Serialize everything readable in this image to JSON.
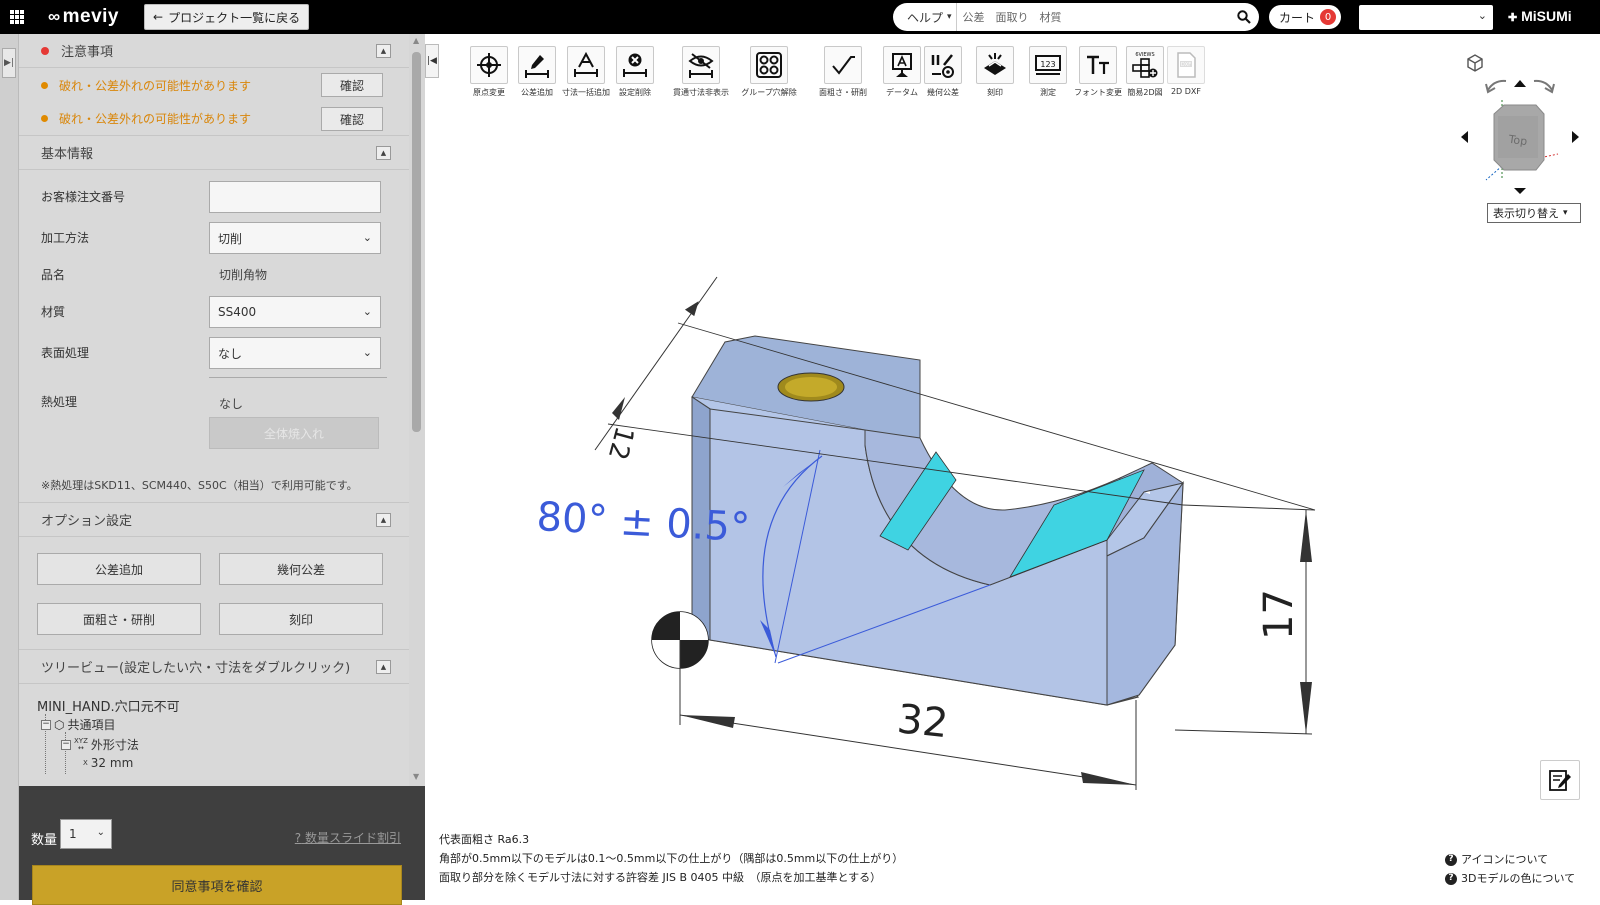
{
  "header": {
    "logo": "meviy",
    "back_button": "プロジェクト一覧に戻る",
    "help_select": "ヘルプ",
    "search_placeholder": "公差　面取り　材質",
    "cart_label": "カート",
    "cart_count": "0",
    "account_select": "",
    "brand": "MiSUMi"
  },
  "notice": {
    "title": "注意事項",
    "items": [
      {
        "text": "破れ・公差外れの可能性があります",
        "button": "確認"
      },
      {
        "text": "破れ・公差外れの可能性があります",
        "button": "確認"
      }
    ]
  },
  "basic_info": {
    "title": "基本情報",
    "order_no_label": "お客様注文番号",
    "order_no_value": "",
    "process_label": "加工方法",
    "process_value": "切削",
    "product_label": "品名",
    "product_value": "切削角物",
    "material_label": "材質",
    "material_value": "SS400",
    "surface_label": "表面処理",
    "surface_value": "なし",
    "heat_label": "熱処理",
    "heat_value": "なし",
    "apply_all_button": "全体焼入れ",
    "heat_note": "※熱処理はSKD11、SCM440、S50C（相当）で利用可能です。"
  },
  "options": {
    "title": "オプション設定",
    "buttons": [
      "公差追加",
      "幾何公差",
      "面粗さ・研削",
      "刻印"
    ]
  },
  "tree": {
    "title": "ツリービュー(設定したい穴・寸法をダブルクリック)",
    "root": "MINI_HAND.穴口元不可",
    "common": "共通項目",
    "outer": "外形寸法",
    "outer_icon_text": "XYZ",
    "x_dim_axis": "X",
    "x_dim": "32 mm"
  },
  "bottom": {
    "qty_label": "数量",
    "qty_value": "1",
    "qty_link": "数量スライド割引",
    "agree_button": "同意事項を確認"
  },
  "toolbar": [
    {
      "icon": "origin-icon",
      "label": "原点変更"
    },
    {
      "icon": "tolerance-add-icon",
      "label": "公差追加"
    },
    {
      "icon": "bulk-dimension-icon",
      "label": "寸法一括追加"
    },
    {
      "icon": "delete-setting-icon",
      "label": "設定削除"
    },
    {
      "icon": "hide-dimension-icon",
      "label": "貫通寸法非表示"
    },
    {
      "icon": "group-hole-icon",
      "label": "グループ穴解除"
    },
    {
      "icon": "roughness-icon",
      "label": "面粗さ・研削"
    },
    {
      "icon": "datum-icon",
      "label": "データム"
    },
    {
      "icon": "geometric-tolerance-icon",
      "label": "幾何公差"
    },
    {
      "icon": "engrave-icon",
      "label": "刻印"
    },
    {
      "icon": "measure-icon",
      "label": "測定"
    },
    {
      "icon": "font-change-icon",
      "label": "フォント変更"
    },
    {
      "icon": "simple-2d-icon",
      "label": "簡易2D図",
      "badge": "6VIEWS"
    },
    {
      "icon": "dxf-icon",
      "label": "2D DXF",
      "badge": "DXF"
    }
  ],
  "viewer": {
    "cube_face": "Top",
    "view_switch": "表示切り替え",
    "dim_width": "32",
    "dim_height": "17",
    "dim_depth": "12",
    "angle_label": "80°  ± 0.5°",
    "model_color": "#b3c4e6",
    "highlight_color": "#3fd3e2"
  },
  "footer": {
    "roughness": "代表面粗さ Ra6.3",
    "corner_note": "角部が0.5mm以下のモデルは0.1～0.5mm以下の仕上がり（隅部は0.5mm以下の仕上がり）",
    "tolerance_note": "面取り部分を除くモデル寸法に対する許容差 JIS B 0405 中級　（原点を加工基準とする）",
    "icon_help": "アイコンについて",
    "color_help": "3Dモデルの色について"
  }
}
